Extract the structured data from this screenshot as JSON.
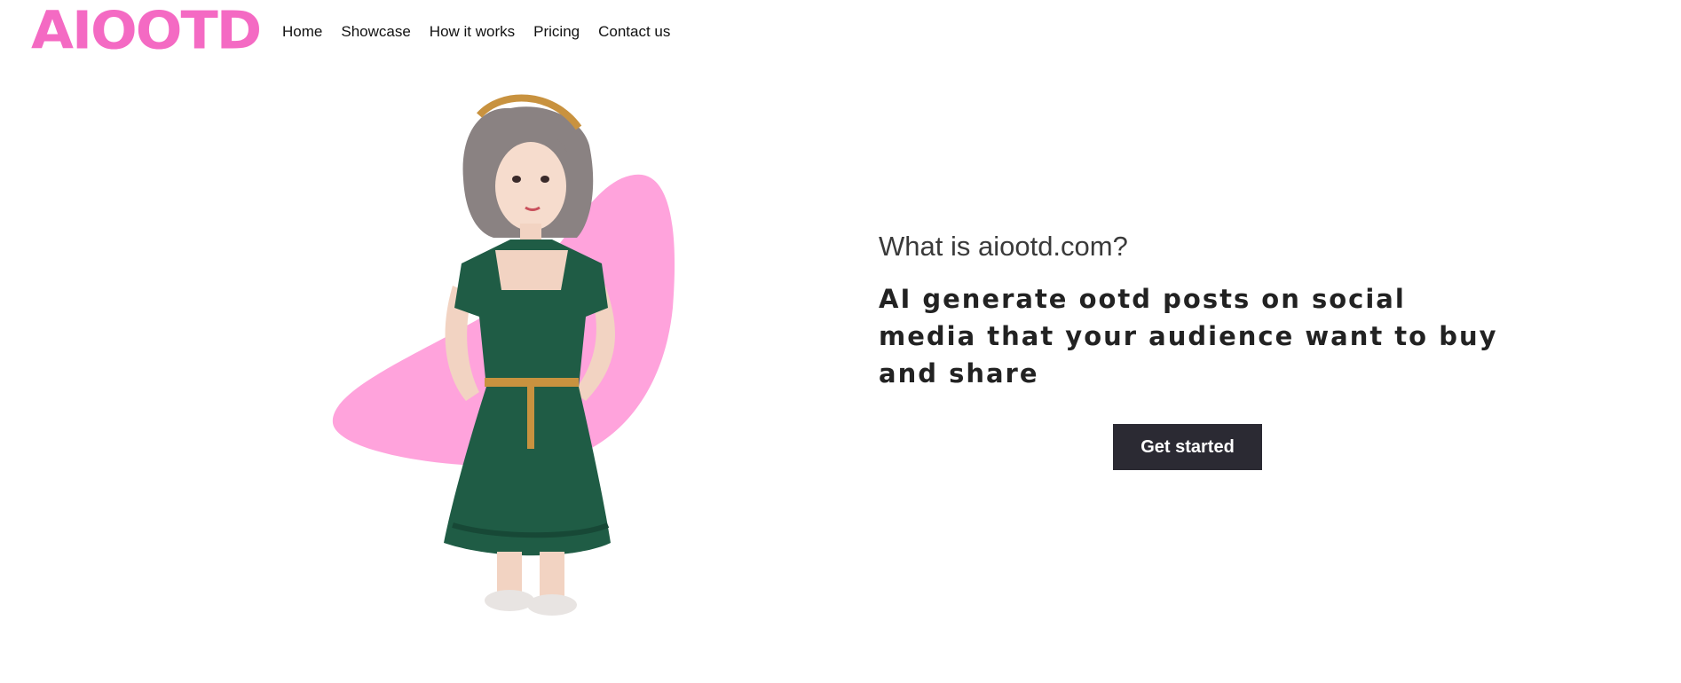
{
  "brand": {
    "logo_text": "AIOOTD",
    "accent_color": "#f46ac3"
  },
  "nav": {
    "items": [
      {
        "label": "Home"
      },
      {
        "label": "Showcase"
      },
      {
        "label": "How it works"
      },
      {
        "label": "Pricing"
      },
      {
        "label": "Contact us"
      }
    ]
  },
  "hero": {
    "kicker": "What is aiootd.com?",
    "headline": "AI generate ootd posts on social media that your audience want to buy and share",
    "cta_label": "Get started",
    "cta_color": "#2b2a33",
    "blob_color": "#ffa3dc",
    "dress_color": "#1f5c45"
  }
}
